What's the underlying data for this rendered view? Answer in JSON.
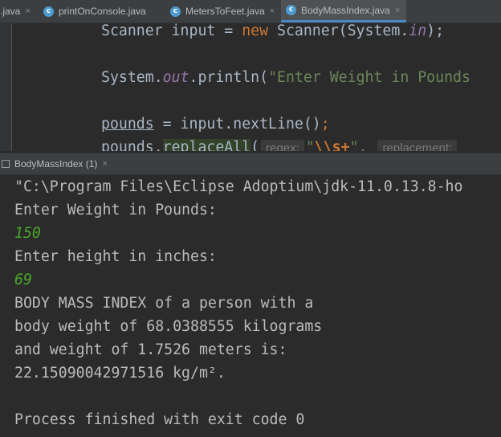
{
  "tabs": [
    {
      "label": ".java",
      "icon": "java-class-icon",
      "active": false
    },
    {
      "label": "printOnConsole.java",
      "icon": "java-class-icon",
      "active": false
    },
    {
      "label": "MetersToFeet.java",
      "icon": "java-class-icon",
      "active": false
    },
    {
      "label": "BodyMassIndex.java",
      "icon": "java-class-icon",
      "active": true
    }
  ],
  "tab_close_glyph": "×",
  "tab_icon_glyph": "c",
  "editor": {
    "line1": {
      "a": "Scanner input = ",
      "kw": "new",
      "b": " Scanner(System.",
      "field": "in",
      "c": ");"
    },
    "line2": {
      "a": "System.",
      "field": "out",
      "b": ".println(",
      "str": "\"Enter Weight in Pounds"
    },
    "line3": {
      "var": "pounds",
      "a": " = input.nextLine()",
      "semi": ";"
    },
    "line4": {
      "var": "pounds",
      "dot": ".",
      "call": "replaceAll",
      "paren": "(",
      "hint1": "regex:",
      "str_open": "\"",
      "esc": "\\\\s+",
      "str_close": "\",",
      "hint2": "replacement:"
    }
  },
  "run_tab": {
    "label": "BodyMassIndex (1)",
    "close": "×"
  },
  "console": [
    {
      "text": "\"C:\\Program Files\\Eclipse Adoptium\\jdk-11.0.13.8-ho",
      "kind": "output"
    },
    {
      "text": "Enter Weight in Pounds:",
      "kind": "output"
    },
    {
      "text": "150",
      "kind": "input"
    },
    {
      "text": "Enter height in inches:",
      "kind": "output"
    },
    {
      "text": "69",
      "kind": "input"
    },
    {
      "text": "BODY MASS INDEX of a person with a",
      "kind": "output"
    },
    {
      "text": "body weight of 68.0388555 kilograms",
      "kind": "output"
    },
    {
      "text": "and weight of 1.7526 meters is:",
      "kind": "output"
    },
    {
      "text": "22.15090042971516 kg/m².",
      "kind": "output"
    },
    {
      "text": "",
      "kind": "output"
    },
    {
      "text": "Process finished with exit code 0",
      "kind": "output"
    }
  ],
  "colors": {
    "background": "#2b2b2b",
    "keyword": "#cc7832",
    "field": "#9876aa",
    "string": "#6a8759",
    "user_input": "#4aa72a",
    "tab_active_underline": "#4a88c7"
  }
}
